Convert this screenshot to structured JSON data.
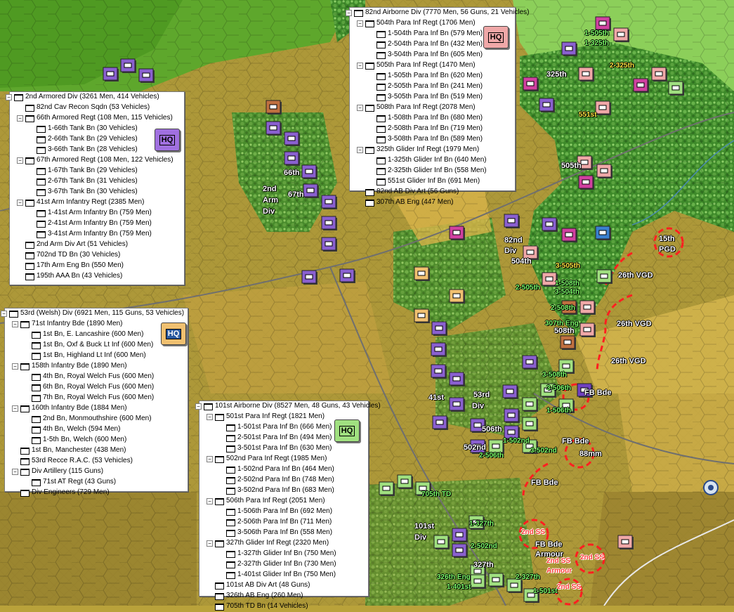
{
  "colors": {
    "hq_armored": "#a070e0",
    "hq_welsh": "#f0c070",
    "hq_airborne": "#a0e080",
    "hq_82nd": "#f0a8a8",
    "axis_red": "#ff2020"
  },
  "panels": {
    "armored": {
      "title": "2nd Armored Div (3261 Men, 414 Vehicles)",
      "hq_label": "HQ",
      "rows": [
        "82nd Cav Recon Sqdn (53 Vehicles)",
        "66th Armored Regt (108 Men, 115 Vehicles)",
        "1-66th Tank Bn (30 Vehicles)",
        "2-66th Tank Bn (29 Vehicles)",
        "3-66th Tank Bn (28 Vehicles)",
        "67th Armored Regt (108 Men, 122 Vehicles)",
        "1-67th Tank Bn (29 Vehicles)",
        "2-67th Tank Bn (31 Vehicles)",
        "3-67th Tank Bn (30 Vehicles)",
        "41st Arm Infantry Regt (2385 Men)",
        "1-41st Arm Infantry Bn (759 Men)",
        "2-41st Arm Infantry Bn (759 Men)",
        "3-41st Arm Infantry Bn (759 Men)",
        "2nd Arm Div Art (51 Vehicles)",
        "702nd TD Bn (30 Vehicles)",
        "17th Arm Eng Bn (550 Men)",
        "195th AAA Bn (43 Vehicles)"
      ]
    },
    "welsh": {
      "title": "53rd (Welsh) Div (6921 Men, 115 Guns, 53 Vehicles)",
      "hq_label": "HQ",
      "rows": [
        "71st Infantry Bde (1890 Men)",
        "1st Bn, E. Lancashire (600 Men)",
        "1st Bn, Oxf & Buck Lt Inf (600 Men)",
        "1st Bn, Highland Lt Inf (600 Men)",
        "158th Infantry Bde (1890 Men)",
        "4th Bn, Royal Welch Fus (600 Men)",
        "6th Bn, Royal Welch Fus (600 Men)",
        "7th Bn, Royal Welch Fus (600 Men)",
        "160th Infantry Bde (1884 Men)",
        "2nd Bn, Monmouthshire (600 Men)",
        "4th Bn, Welch (594 Men)",
        "1-5th Bn, Welch (600 Men)",
        "1st Bn, Manchester (438 Men)",
        "53rd Recce R.A.C. (53 Vehicles)",
        "Div Artillery (115 Guns)",
        "71st AT Regt (43 Guns)",
        "Div Engineers (729 Men)"
      ]
    },
    "airborne101": {
      "title": "101st Airborne Div (8527 Men, 48 Guns, 43 Vehicles)",
      "hq_label": "HQ",
      "rows": [
        "501st Para Inf Regt (1821 Men)",
        "1-501st Para Inf Bn (666 Men)",
        "2-501st Para Inf Bn (494 Men)",
        "3-501st Para Inf Bn (630 Men)",
        "502nd Para Inf Regt (1985 Men)",
        "1-502nd Para Inf Bn (464 Men)",
        "2-502nd Para Inf Bn (748 Men)",
        "3-502nd Para Inf Bn (683 Men)",
        "506th Para Inf Regt (2051 Men)",
        "1-506th Para Inf Bn (692 Men)",
        "2-506th Para Inf Bn (711 Men)",
        "3-506th Para Inf Bn (558 Men)",
        "327th Glider Inf Regt (2320 Men)",
        "1-327th Glider Inf Bn (750 Men)",
        "2-327th Glider Inf Bn (730 Men)",
        "1-401st Glider Inf Bn (750 Men)",
        "101st AB Div Art (48 Guns)",
        "326th AB Eng (260 Men)",
        "705th TD Bn (14 Vehicles)"
      ]
    },
    "airborne82": {
      "title": "82nd Airborne Div (7770 Men, 56 Guns, 21 Vehicles)",
      "hq_label": "HQ",
      "rows": [
        "504th Para Inf Regt (1706 Men)",
        "1-504th Para Inf Bn (579 Men)",
        "2-504th Para Inf Bn (432 Men)",
        "3-504th Para Inf Bn (605 Men)",
        "505th Para Inf Regt (1470 Men)",
        "1-505th Para Inf Bn (620 Men)",
        "2-505th Para Inf Bn (241 Men)",
        "3-505th Para Inf Bn (519 Men)",
        "508th Para Inf Regt (2078 Men)",
        "1-508th Para Inf Bn (680 Men)",
        "2-508th Para Inf Bn (719 Men)",
        "3-508th Para Inf Bn (589 Men)",
        "325th Glider Inf Regt (1979 Men)",
        "1-325th Glider Inf Bn (640 Men)",
        "2-325th Glider Inf Bn (558 Men)",
        "551st Glider Inf Bn (691 Men)",
        "82nd AB Div Art (56 Guns)",
        "307th AB Eng (447 Men)"
      ]
    }
  },
  "map_labels": {
    "white": [
      "66th",
      "67th",
      "2nd",
      "Arm",
      "Div",
      "82nd",
      "Div",
      "504th",
      "41st",
      "53rd",
      "Div",
      "506th",
      "502nd",
      "101st",
      "Div",
      "327th",
      "325th",
      "505th",
      "508th",
      "15th",
      "PGD",
      "26th VGD",
      "26th VGD",
      "26th VGD",
      "FB Bde",
      "FB Bde",
      "FB Bde",
      "88mm",
      "FB Bde",
      "Armour"
    ],
    "green": [
      "1-505th",
      "1-325th",
      "2-505th",
      "1-508th",
      "3-504th",
      "2-508th",
      "307th Eng",
      "3-508th",
      "3-506th",
      "1-506th",
      "1-502nd",
      "2-506th",
      "3-502nd",
      "705th TD",
      "1-327th",
      "2-502nd",
      "326th Eng",
      "1-401st",
      "2-327th",
      "1-501st"
    ],
    "yellow": [
      "2-325th",
      "551st",
      "3-505th"
    ],
    "red": [
      "2nd SS",
      "2nd SS",
      "2nd SS",
      "Armour",
      "2nd SS"
    ]
  }
}
